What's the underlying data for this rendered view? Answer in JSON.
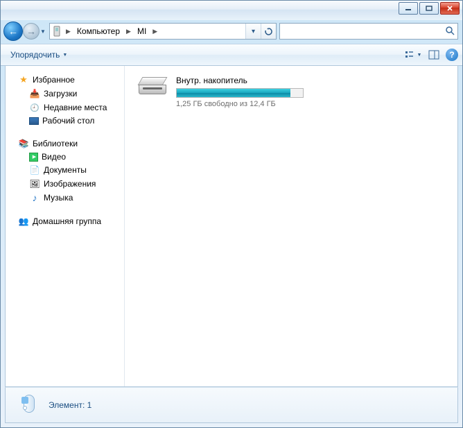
{
  "breadcrumb": {
    "seg1": "Компьютер",
    "seg2": "MI"
  },
  "search": {
    "placeholder": ""
  },
  "toolbar": {
    "organize": "Упорядочить"
  },
  "sidebar": {
    "favorites": {
      "label": "Избранное"
    },
    "downloads": {
      "label": "Загрузки"
    },
    "recent": {
      "label": "Недавние места"
    },
    "desktop": {
      "label": "Рабочий стол"
    },
    "libraries": {
      "label": "Библиотеки"
    },
    "video": {
      "label": "Видео"
    },
    "documents": {
      "label": "Документы"
    },
    "images": {
      "label": "Изображения"
    },
    "music": {
      "label": "Музыка"
    },
    "homegroup": {
      "label": "Домашняя группа"
    }
  },
  "drive": {
    "name": "Внутр. накопитель",
    "status": "1,25 ГБ свободно из 12,4 ГБ",
    "fill_percent": 90
  },
  "details": {
    "text": "Элемент: 1"
  }
}
